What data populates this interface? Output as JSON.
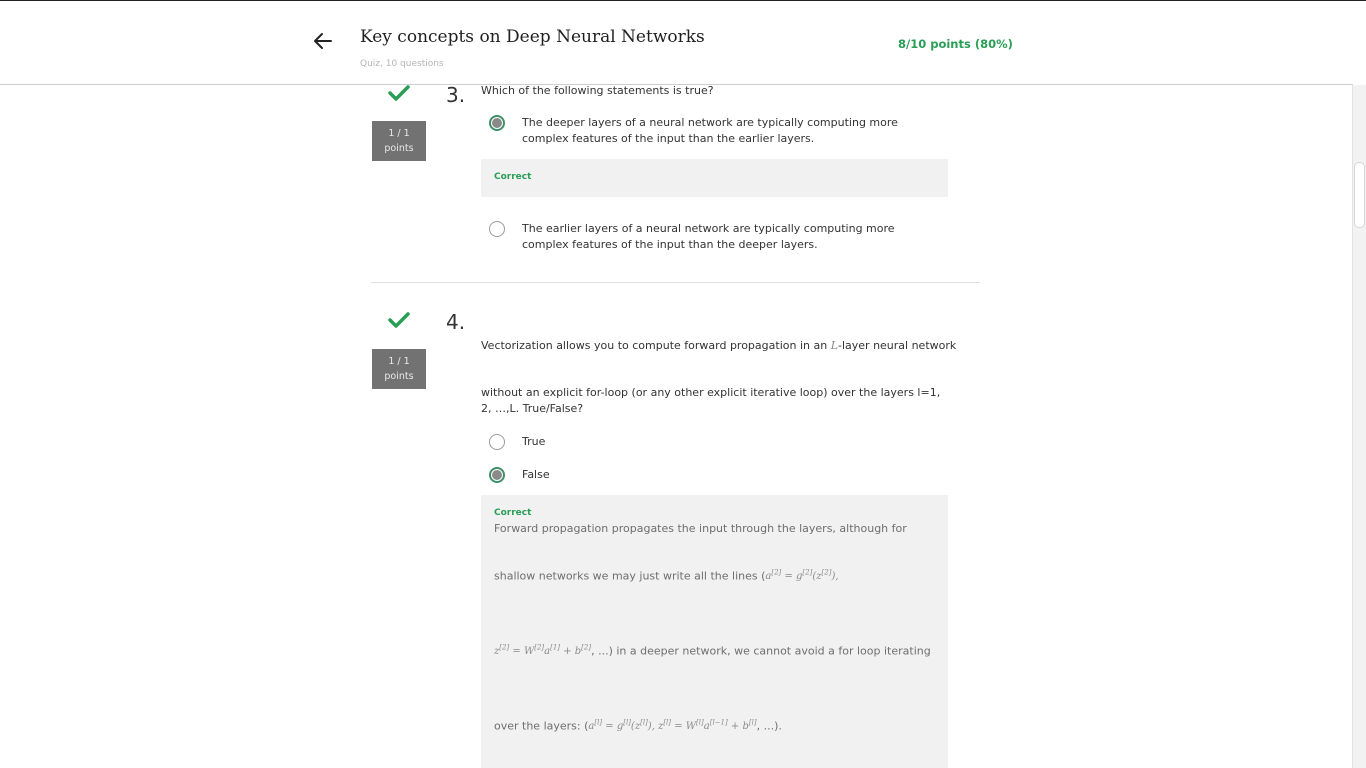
{
  "header": {
    "title": "Key concepts on Deep Neural Networks",
    "subtitle": "Quiz, 10 questions",
    "score": "8/10 points (80%)"
  },
  "icons": {
    "back": "arrow-left-icon",
    "check": "checkmark-icon"
  },
  "colors": {
    "accent_green": "#2a9d57",
    "badge_gray": "#727272",
    "feedback_bg": "#f1f1f1"
  },
  "questions": [
    {
      "number": "3.",
      "points_line1": "1 / 1",
      "points_line2": "points",
      "text": "Which of the following statements is true?",
      "options": [
        {
          "text": "The deeper layers of a neural network are typically computing more complex features of the input than the earlier layers.",
          "selected": true
        },
        {
          "text": "The earlier layers of a neural network are typically computing more complex features of the input than the deeper layers.",
          "selected": false
        }
      ],
      "feedback_label": "Correct"
    },
    {
      "number": "4.",
      "points_line1": "1 / 1",
      "points_line2": "points",
      "text_part1": "Vectorization allows you to compute forward propagation in an ",
      "text_math_L": "L",
      "text_part2": "-layer neural network",
      "text_line2": "without an explicit for-loop (or any other explicit iterative loop) over the layers l=1, 2, …,L. True/False?",
      "options": [
        {
          "text": "True",
          "selected": false
        },
        {
          "text": "False",
          "selected": true
        }
      ],
      "feedback_label": "Correct",
      "feedback_line1": "Forward propagation propagates the input through the layers, although for",
      "feedback_line2": "shallow networks we may just write all the lines (",
      "feedback_line3_tail": ", ...) in a deeper network, we cannot avoid a for loop iterating",
      "feedback_line4": "over the layers: (",
      "feedback_line4_tail": ", ...)."
    }
  ]
}
